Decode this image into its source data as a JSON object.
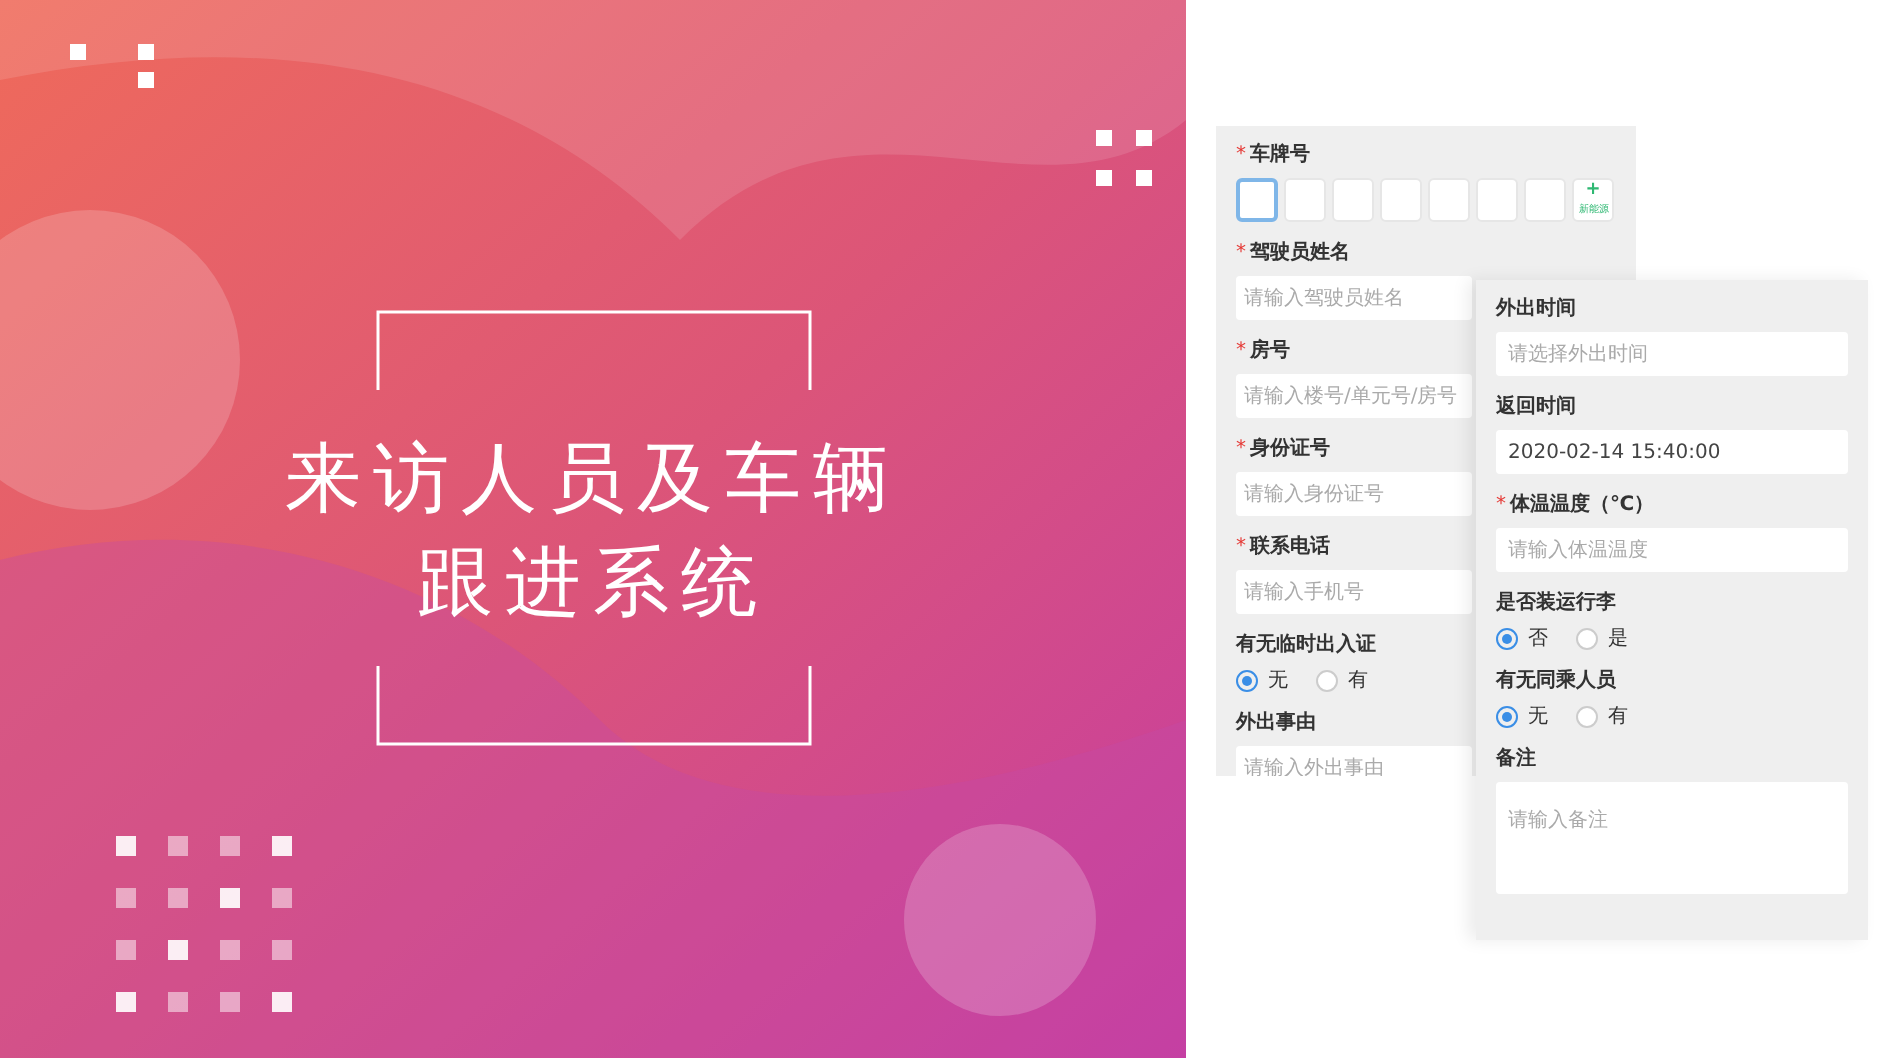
{
  "banner": {
    "title_lines": [
      "来访人员及车辆",
      "跟进系统"
    ]
  },
  "form_left": {
    "fields": [
      {
        "kind": "plate",
        "label": "车牌号",
        "required_mark": "*",
        "plate_boxes": [
          {
            "focused": true
          },
          {
            "focused": false
          },
          {
            "focused": false
          },
          {
            "focused": false
          },
          {
            "focused": false
          },
          {
            "focused": false
          },
          {
            "focused": false
          }
        ],
        "extra_button": {
          "icon": "+",
          "label": "新能源"
        }
      },
      {
        "kind": "input",
        "label": "驾驶员姓名",
        "required_mark": "*",
        "placeholder": "请输入驾驶员姓名"
      },
      {
        "kind": "input",
        "label": "房号",
        "required_mark": "*",
        "placeholder": "请输入楼号/单元号/房号"
      },
      {
        "kind": "input",
        "label": "身份证号",
        "required_mark": "*",
        "placeholder": "请输入身份证号"
      },
      {
        "kind": "input",
        "label": "联系电话",
        "required_mark": "*",
        "placeholder": "请输入手机号"
      },
      {
        "kind": "radio",
        "label": "有无临时出入证",
        "options": [
          {
            "label": "无",
            "selected": true
          },
          {
            "label": "有",
            "selected": false
          }
        ]
      },
      {
        "kind": "input",
        "label": "外出事由",
        "placeholder": "请输入外出事由"
      }
    ]
  },
  "form_right": {
    "fields": [
      {
        "kind": "input",
        "label": "外出时间",
        "placeholder": "请选择外出时间"
      },
      {
        "kind": "input",
        "label": "返回时间",
        "value": "2020-02-14 15:40:00"
      },
      {
        "kind": "input",
        "label": "体温温度（℃）",
        "required_mark": "*",
        "placeholder": "请输入体温温度"
      },
      {
        "kind": "radio",
        "label": "是否装运行李",
        "options": [
          {
            "label": "否",
            "selected": true
          },
          {
            "label": "是",
            "selected": false
          }
        ]
      },
      {
        "kind": "radio",
        "label": "有无同乘人员",
        "options": [
          {
            "label": "无",
            "selected": true
          },
          {
            "label": "有",
            "selected": false
          }
        ]
      },
      {
        "kind": "textarea",
        "label": "备注",
        "placeholder": "请输入备注"
      }
    ]
  }
}
